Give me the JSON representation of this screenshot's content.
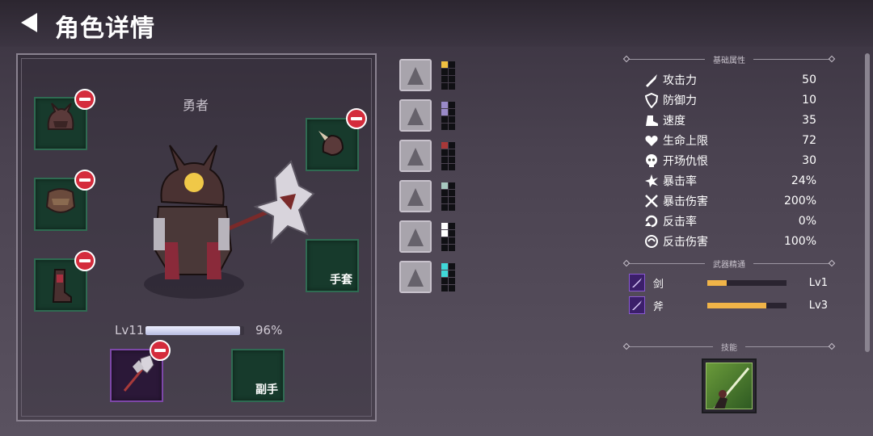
{
  "header": {
    "title": "角色详情"
  },
  "hero": {
    "name": "勇者",
    "level_label": "Lv11",
    "xp_percent_label": "96%",
    "xp_fraction": 0.96
  },
  "slots": {
    "gloves_label": "手套",
    "offhand_label": "副手"
  },
  "cards": [
    {
      "icon": "shadow-assassin-card",
      "meter_color": "#f0c040",
      "filled": 1
    },
    {
      "icon": "armored-knight-card",
      "meter_color": "#9a8ac8",
      "filled": 2
    },
    {
      "icon": "sword-slash-card",
      "meter_color": "#a83838",
      "filled": 1
    },
    {
      "icon": "claw-strike-card",
      "meter_color": "#a8c8c0",
      "filled": 1
    },
    {
      "icon": "winged-shield-card",
      "meter_color": "#ffffff",
      "filled": 2
    },
    {
      "icon": "ice-crystal-card",
      "meter_color": "#40d8d8",
      "filled": 2
    }
  ],
  "sections": {
    "base_attributes": "基础属性",
    "weapon_mastery": "武器精通",
    "skills": "技能"
  },
  "stats": [
    {
      "icon": "sword-icon",
      "name": "攻击力",
      "value": "50"
    },
    {
      "icon": "shield-icon",
      "name": "防御力",
      "value": "10"
    },
    {
      "icon": "boot-icon",
      "name": "速度",
      "value": "35"
    },
    {
      "icon": "heart-icon",
      "name": "生命上限",
      "value": "72"
    },
    {
      "icon": "skull-icon",
      "name": "开场仇恨",
      "value": "30"
    },
    {
      "icon": "burst-icon",
      "name": "暴击率",
      "value": "24%"
    },
    {
      "icon": "crossed-swords-icon",
      "name": "暴击伤害",
      "value": "200%"
    },
    {
      "icon": "counter-icon",
      "name": "反击率",
      "value": "0%"
    },
    {
      "icon": "swirl-icon",
      "name": "反击伤害",
      "value": "100%"
    }
  ],
  "mastery": [
    {
      "icon": "sword-mastery-icon",
      "name": "剑",
      "level": "Lv1",
      "fraction": 0.25
    },
    {
      "icon": "axe-mastery-icon",
      "name": "斧",
      "level": "Lv3",
      "fraction": 0.75
    }
  ],
  "colors": {
    "slot_bg": "#173a2c",
    "weapon_slot_bg": "#2b1838",
    "remove_badge": "#d42c3c",
    "mastery_fill": "#f0b448"
  }
}
